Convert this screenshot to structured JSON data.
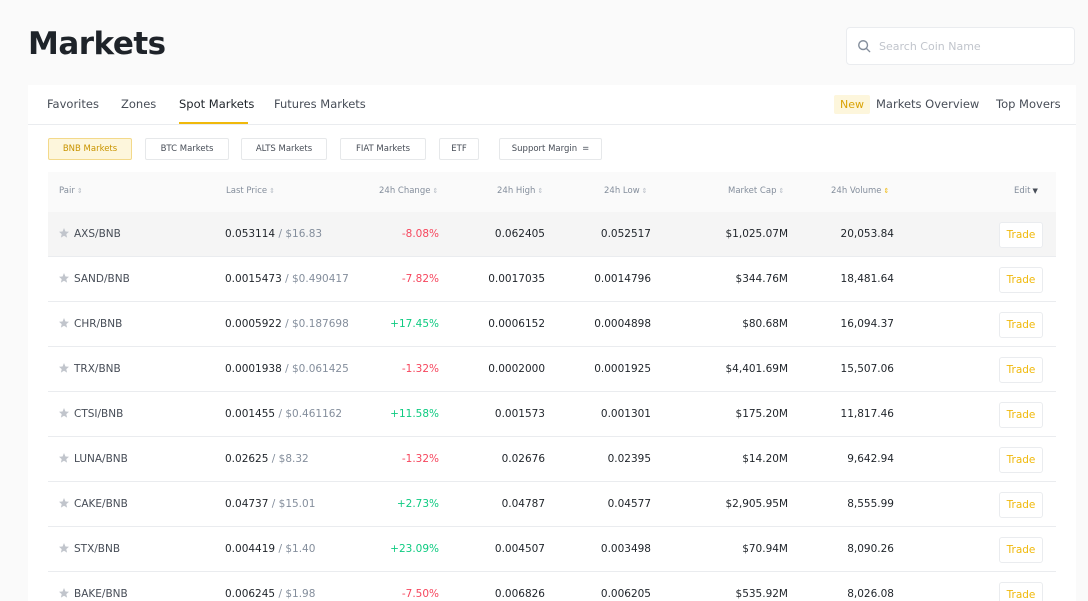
{
  "page": {
    "title": "Markets"
  },
  "search": {
    "placeholder": "Search Coin Name",
    "icon": "search-icon"
  },
  "tabs": {
    "left": [
      "Favorites",
      "Zones",
      "Spot Markets",
      "Futures Markets"
    ],
    "active": "Spot Markets",
    "new_badge": "New",
    "right": [
      "Markets Overview",
      "Top Movers"
    ]
  },
  "filters": [
    "BNB Markets",
    "BTC Markets",
    "ALTS Markets",
    "FIAT Markets",
    "ETF",
    "Support Margin"
  ],
  "filters_active": "BNB Markets",
  "filters_dropdown_glyph": "=",
  "table": {
    "headers": {
      "pair": "Pair",
      "last_price": "Last Price",
      "change": "24h Change",
      "high": "24h High",
      "low": "24h Low",
      "market_cap": "Market Cap",
      "volume": "24h Volume",
      "edit": "Edit"
    },
    "sorted_by": "24h Volume",
    "trade_label": "Trade",
    "rows": [
      {
        "pair": "AXS/BNB",
        "price": "0.053114",
        "usd": "$16.83",
        "change": "-8.08%",
        "high": "0.062405",
        "low": "0.052517",
        "cap": "$1,025.07M",
        "volume": "20,053.84"
      },
      {
        "pair": "SAND/BNB",
        "price": "0.0015473",
        "usd": "$0.490417",
        "change": "-7.82%",
        "high": "0.0017035",
        "low": "0.0014796",
        "cap": "$344.76M",
        "volume": "18,481.64"
      },
      {
        "pair": "CHR/BNB",
        "price": "0.0005922",
        "usd": "$0.187698",
        "change": "+17.45%",
        "high": "0.0006152",
        "low": "0.0004898",
        "cap": "$80.68M",
        "volume": "16,094.37"
      },
      {
        "pair": "TRX/BNB",
        "price": "0.0001938",
        "usd": "$0.061425",
        "change": "-1.32%",
        "high": "0.0002000",
        "low": "0.0001925",
        "cap": "$4,401.69M",
        "volume": "15,507.06"
      },
      {
        "pair": "CTSI/BNB",
        "price": "0.001455",
        "usd": "$0.461162",
        "change": "+11.58%",
        "high": "0.001573",
        "low": "0.001301",
        "cap": "$175.20M",
        "volume": "11,817.46"
      },
      {
        "pair": "LUNA/BNB",
        "price": "0.02625",
        "usd": "$8.32",
        "change": "-1.32%",
        "high": "0.02676",
        "low": "0.02395",
        "cap": "$14.20M",
        "volume": "9,642.94"
      },
      {
        "pair": "CAKE/BNB",
        "price": "0.04737",
        "usd": "$15.01",
        "change": "+2.73%",
        "high": "0.04787",
        "low": "0.04577",
        "cap": "$2,905.95M",
        "volume": "8,555.99"
      },
      {
        "pair": "STX/BNB",
        "price": "0.004419",
        "usd": "$1.40",
        "change": "+23.09%",
        "high": "0.004507",
        "low": "0.003498",
        "cap": "$70.94M",
        "volume": "8,090.26"
      },
      {
        "pair": "BAKE/BNB",
        "price": "0.006245",
        "usd": "$1.98",
        "change": "-7.50%",
        "high": "0.006826",
        "low": "0.006205",
        "cap": "$535.92M",
        "volume": "8,026.08"
      }
    ]
  },
  "colors": {
    "accent": "#f0b90b",
    "negative": "#f6465d",
    "positive": "#0ecb81",
    "text": "#1e2329",
    "muted": "#848e9c"
  }
}
